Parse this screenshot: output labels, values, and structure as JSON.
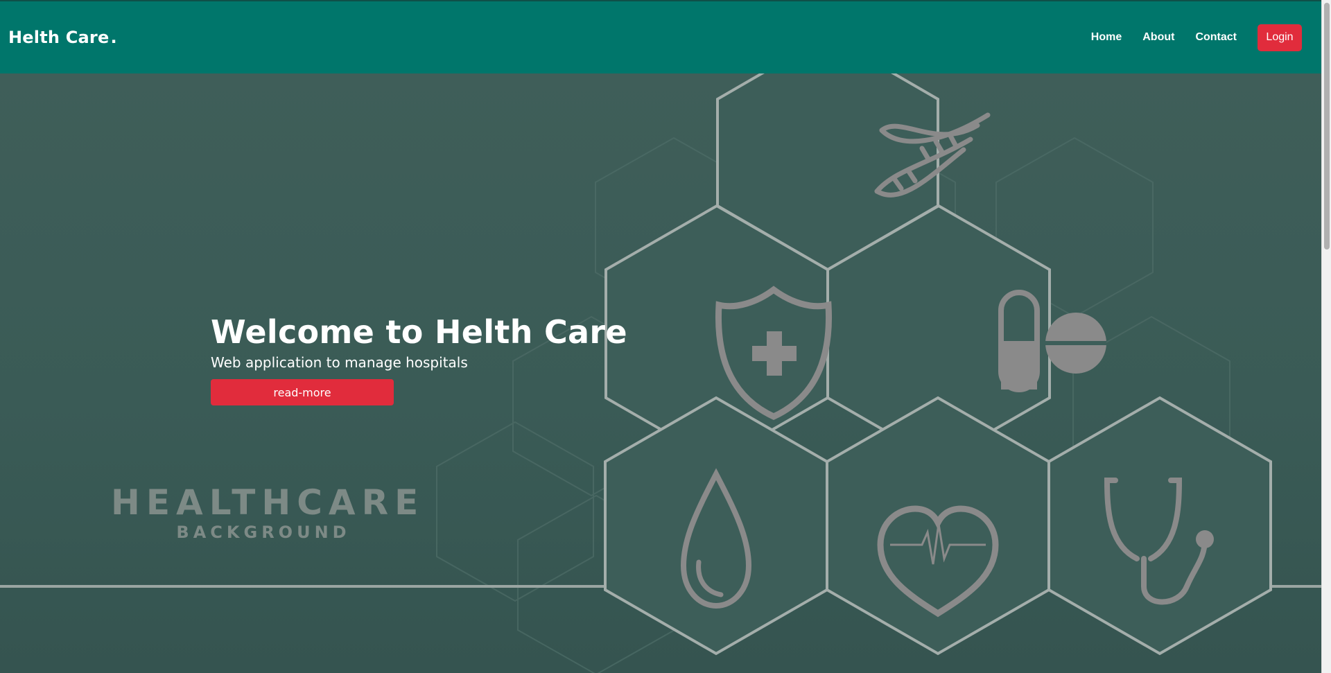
{
  "nav": {
    "brand": "Helth Care",
    "brand_dot": ".",
    "links": [
      "Home",
      "About",
      "Contact"
    ],
    "login_label": "Login"
  },
  "hero": {
    "title": "Welcome to Helth Care",
    "subtitle": "Web application to manage hospitals",
    "button_label": "read-more",
    "watermark_main": "HEALTHCARE",
    "watermark_sub": "BACKGROUND"
  },
  "colors": {
    "navbar": "#00766b",
    "accent_red": "#e12c3c",
    "hero_bg": "#3a5a55",
    "icon_gray": "#8a8a8a"
  },
  "icons": [
    "dna-icon",
    "shield-cross-icon",
    "pills-icon",
    "blood-drop-icon",
    "heart-pulse-icon",
    "stethoscope-icon"
  ]
}
